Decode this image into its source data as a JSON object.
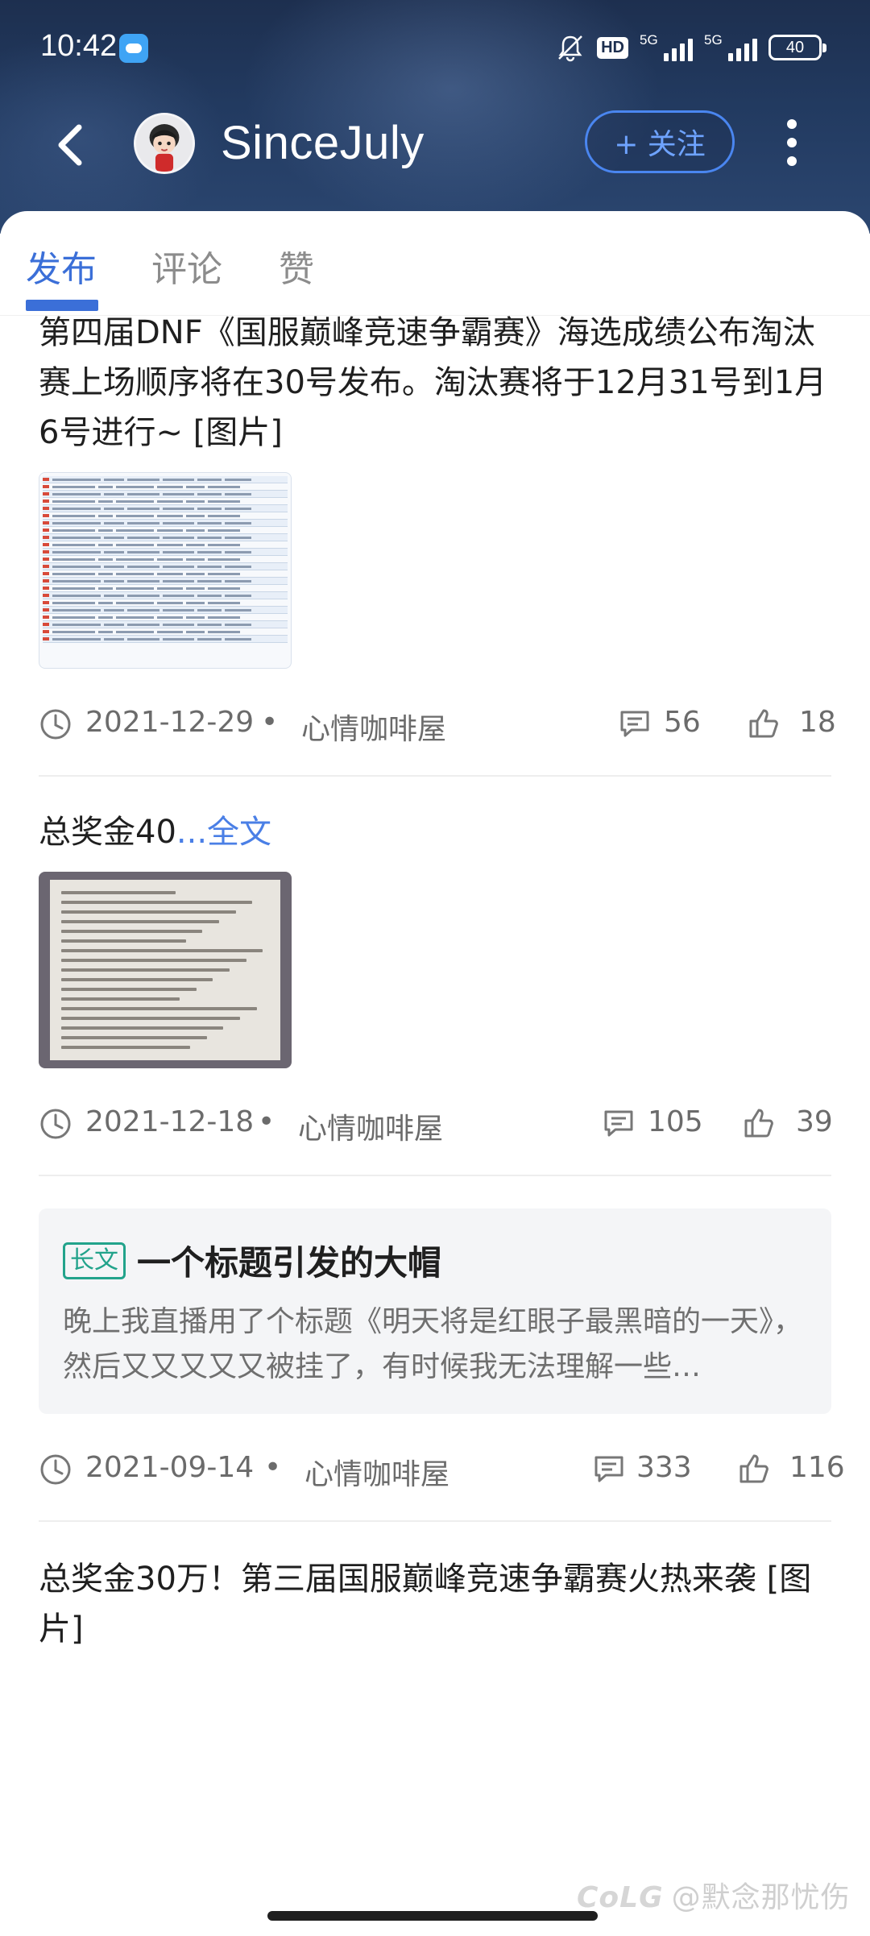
{
  "status_bar": {
    "time": "10:42",
    "hd": "HD",
    "net1": "5G",
    "net2": "5G",
    "battery": "40"
  },
  "header": {
    "username": "SinceJuly",
    "follow_label": "+ 关注"
  },
  "tabs": [
    {
      "label": "发布",
      "active": true
    },
    {
      "label": "评论",
      "active": false
    },
    {
      "label": "赞",
      "active": false
    }
  ],
  "posts": [
    {
      "text": "第四届DNF《国服巅峰竞速争霸赛》海选成绩公布淘汰赛上场顺序将在30号发布。淘汰赛将于12月31号到1月6号进行~ [图片]",
      "date": "2021-12-29",
      "circle": "心情咖啡屋",
      "comments": "56",
      "likes": "18"
    },
    {
      "text": "总奖金40",
      "more": "...全文",
      "date": "2021-12-18",
      "circle": "心情咖啡屋",
      "comments": "105",
      "likes": "39"
    },
    {
      "badge": "长文",
      "title": "一个标题引发的大帽",
      "excerpt": "晚上我直播用了个标题《明天将是红眼子最黑暗的一天》，然后又又又又又被挂了，有时候我无法理解一些…",
      "date": "2021-09-14",
      "circle": "心情咖啡屋",
      "comments": "333",
      "likes": "116"
    },
    {
      "text": "总奖金30万！第三届国服巅峰竞速争霸赛火热来袭 [图片]"
    }
  ],
  "meta": {
    "separator": "•"
  },
  "watermark": {
    "logo": "CoLG",
    "text": "@默念那忧伤"
  },
  "colors": {
    "accent": "#3b6fd8",
    "long_badge": "#22a38b",
    "header_bg": "#1d2f4f"
  }
}
